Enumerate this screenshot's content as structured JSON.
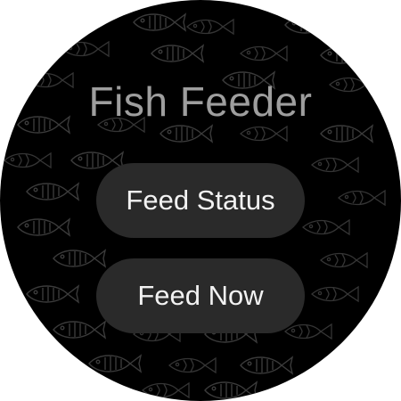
{
  "app": {
    "title": "Fish Feeder"
  },
  "buttons": {
    "feed_status": "Feed Status",
    "feed_now": "Feed Now"
  },
  "background": {
    "pattern": "fish-pattern",
    "color": "#000000",
    "pattern_color": "#3a3a3a"
  },
  "colors": {
    "title": "#9e9e9e",
    "button_bg": "#2a2a2a",
    "button_text": "#f2f2f2"
  }
}
